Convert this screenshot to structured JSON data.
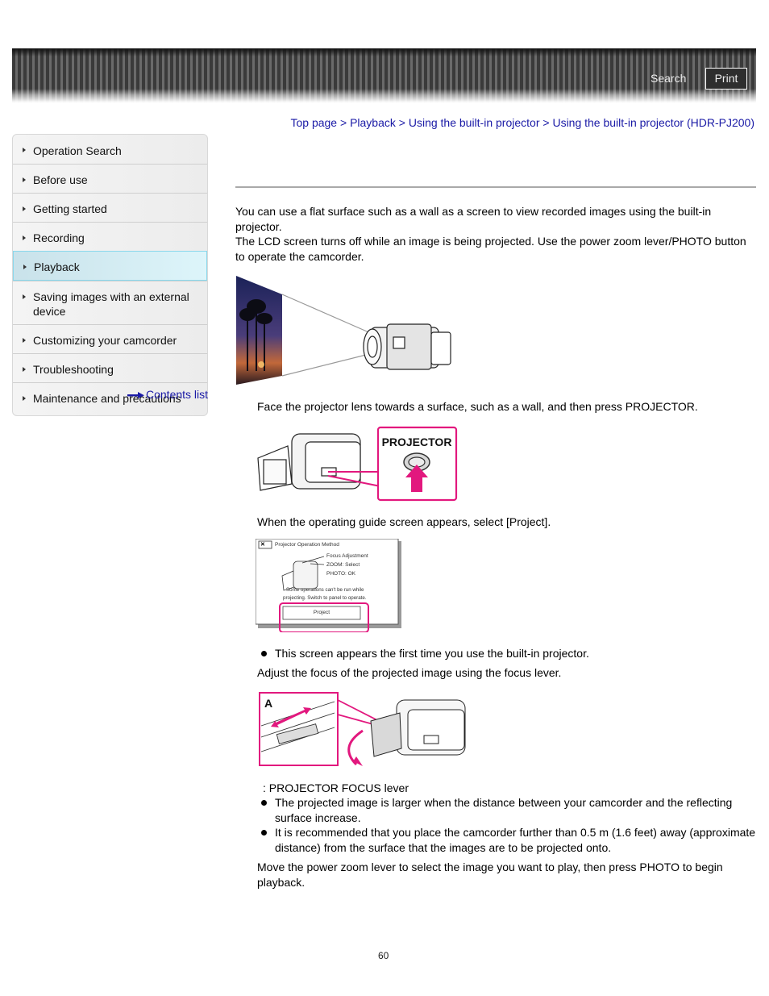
{
  "header": {
    "search_label": "Search",
    "print_label": "Print"
  },
  "breadcrumb": {
    "items": [
      "Top page",
      "Playback",
      "Using the built-in projector",
      "Using the built-in projector (HDR-PJ200)"
    ],
    "separator": ">"
  },
  "sidebar": {
    "items": [
      {
        "label": "Operation Search",
        "active": false
      },
      {
        "label": "Before use",
        "active": false
      },
      {
        "label": "Getting started",
        "active": false
      },
      {
        "label": "Recording",
        "active": false
      },
      {
        "label": "Playback",
        "active": true
      },
      {
        "label": "Saving images with an external device",
        "active": false
      },
      {
        "label": "Customizing your camcorder",
        "active": false
      },
      {
        "label": "Troubleshooting",
        "active": false
      },
      {
        "label": "Maintenance and precautions",
        "active": false
      }
    ],
    "contents_link": "Contents list"
  },
  "main": {
    "intro_line1": "You can use a flat surface such as a wall as a screen to view recorded images using the built-in projector.",
    "intro_line2": "The LCD screen turns off while an image is being projected. Use the power zoom lever/PHOTO button to operate the camcorder.",
    "step1": "Face the projector lens towards a surface, such as a wall, and then press PROJECTOR.",
    "figure2_label": "PROJECTOR",
    "step2": "When the operating guide screen appears, select [Project].",
    "figure3": {
      "title": "Projector Operation Method",
      "close_glyph": "✕",
      "line_focus": "Focus Adjustment",
      "line_zoom": "ZOOM: Select",
      "line_photo": "PHOTO: OK",
      "note1": "Some operations can't be run while",
      "note2": "projecting. Switch to panel to operate.",
      "button": "Project"
    },
    "note_first_time": "This screen appears the first time you use the built-in projector.",
    "step3": "Adjust the focus of the projected image using the focus lever.",
    "figure4_label": "A",
    "legend_a": ": PROJECTOR FOCUS lever",
    "bullet_larger": "The projected image is larger when the distance between your camcorder and the reflecting surface increase.",
    "bullet_distance": "It is recommended that you place the camcorder further than 0.5 m (1.6 feet) away (approximate distance) from the surface that the images are to be projected onto.",
    "step4": "Move the power zoom lever to select the image you want to play, then press PHOTO to begin playback."
  },
  "footer": {
    "page_number": "60"
  },
  "colors": {
    "link": "#1a1aa6",
    "highlight_pink": "#e2187e",
    "active_nav_border": "#8ad8ec"
  }
}
